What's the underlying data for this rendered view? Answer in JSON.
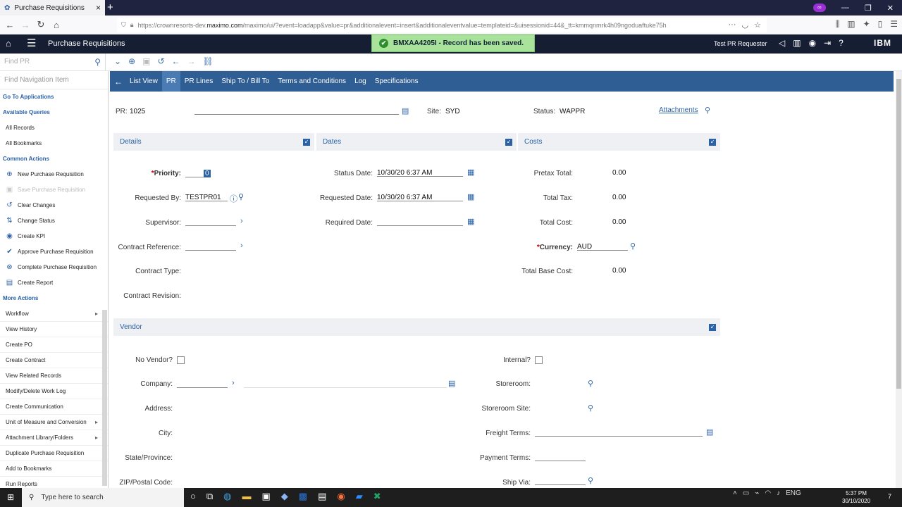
{
  "browser": {
    "tab_title": "Purchase Requisitions",
    "new_tab": "+",
    "url_prefix": "https://crownresorts-dev.",
    "url_domain": "maximo.com",
    "url_rest": "/maximo/ui/?event=loadapp&value=pr&additionalevent=insert&additionaleventvalue=templateid=&uisessionid=44&_tt=kmmqnmrk4h09ngoduaftuke75h"
  },
  "header": {
    "app_title": "Purchase Requisitions",
    "user": "Test PR Requester",
    "brand": "IBM"
  },
  "toast": {
    "message": "BMXAA4205I - Record has been saved."
  },
  "toolbar": {
    "find_placeholder": "Find PR"
  },
  "leftnav": {
    "find_placeholder": "Find Navigation Item",
    "go_to": "Go To Applications",
    "queries_head": "Available Queries",
    "queries": [
      "All Records",
      "All Bookmarks"
    ],
    "common_head": "Common Actions",
    "common": [
      {
        "label": "New Purchase Requisition",
        "icon": "plus-circle-icon",
        "glyph": "⊕",
        "disabled": false
      },
      {
        "label": "Save Purchase Requisition",
        "icon": "save-icon",
        "glyph": "▣",
        "disabled": true
      },
      {
        "label": "Clear Changes",
        "icon": "undo-icon",
        "glyph": "↺",
        "disabled": false
      },
      {
        "label": "Change Status",
        "icon": "status-icon",
        "glyph": "⇅",
        "disabled": false
      },
      {
        "label": "Create KPI",
        "icon": "kpi-icon",
        "glyph": "◉",
        "disabled": false
      },
      {
        "label": "Approve Purchase Requisition",
        "icon": "check-icon",
        "glyph": "✔",
        "disabled": false
      },
      {
        "label": "Complete Purchase Requisition",
        "icon": "complete-icon",
        "glyph": "⊗",
        "disabled": false
      },
      {
        "label": "Create Report",
        "icon": "report-icon",
        "glyph": "▤",
        "disabled": false
      }
    ],
    "more_head": "More Actions",
    "more": [
      {
        "label": "Workflow",
        "sub": true
      },
      {
        "label": "View History",
        "sub": false
      },
      {
        "label": "Create PO",
        "sub": false
      },
      {
        "label": "Create Contract",
        "sub": false
      },
      {
        "label": "View Related Records",
        "sub": false
      },
      {
        "label": "Modify/Delete Work Log",
        "sub": false
      },
      {
        "label": "Create Communication",
        "sub": false
      },
      {
        "label": "Unit of Measure and Conversion",
        "sub": true
      },
      {
        "label": "Attachment Library/Folders",
        "sub": true
      },
      {
        "label": "Duplicate Purchase Requisition",
        "sub": false
      },
      {
        "label": "Add to Bookmarks",
        "sub": false
      },
      {
        "label": "Run Reports",
        "sub": false
      }
    ]
  },
  "tabs": {
    "list_view": "List View",
    "items": [
      "PR",
      "PR Lines",
      "Ship To / Bill To",
      "Terms and Conditions",
      "Log",
      "Specifications"
    ],
    "active": "PR"
  },
  "record": {
    "pr_label": "PR:",
    "pr_value": "1025",
    "site_label": "Site:",
    "site_value": "SYD",
    "status_label": "Status:",
    "status_value": "WAPPR",
    "attachments": "Attachments"
  },
  "details": {
    "title": "Details",
    "priority_label": "Priority:",
    "priority_value": "0",
    "requested_by_label": "Requested By:",
    "requested_by_value": "TESTPR01",
    "supervisor_label": "Supervisor:",
    "contract_ref_label": "Contract Reference:",
    "contract_type_label": "Contract Type:",
    "contract_rev_label": "Contract Revision:"
  },
  "dates": {
    "title": "Dates",
    "status_date_label": "Status Date:",
    "status_date_value": "10/30/20 6:37 AM",
    "requested_date_label": "Requested Date:",
    "requested_date_value": "10/30/20 6:37 AM",
    "required_date_label": "Required Date:"
  },
  "costs": {
    "title": "Costs",
    "pretax_label": "Pretax Total:",
    "pretax_value": "0.00",
    "tax_label": "Total Tax:",
    "tax_value": "0.00",
    "cost_label": "Total Cost:",
    "cost_value": "0.00",
    "currency_label": "Currency:",
    "currency_value": "AUD",
    "base_label": "Total Base Cost:",
    "base_value": "0.00"
  },
  "vendor": {
    "title": "Vendor",
    "no_vendor_label": "No Vendor?",
    "company_label": "Company:",
    "address_label": "Address:",
    "city_label": "City:",
    "state_label": "State/Province:",
    "zip_label": "ZIP/Postal Code:",
    "internal_label": "Internal?",
    "storeroom_label": "Storeroom:",
    "storeroom_site_label": "Storeroom Site:",
    "freight_label": "Freight Terms:",
    "payment_label": "Payment Terms:",
    "shipvia_label": "Ship Via:"
  },
  "taskbar": {
    "search_placeholder": "Type here to search",
    "lang": "ENG",
    "time": "5:37 PM",
    "date": "30/10/2020",
    "notifications": "7"
  },
  "colors": {
    "tab_bar": "#2f5e94",
    "header": "#151e33",
    "accent": "#2b62a6",
    "toast": "#a9e29a"
  }
}
